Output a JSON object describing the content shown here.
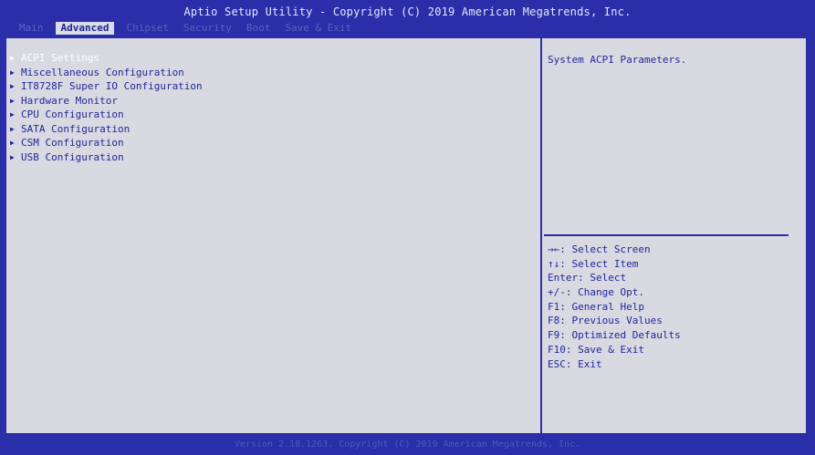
{
  "header": {
    "title": "Aptio Setup Utility - Copyright (C) 2019 American Megatrends, Inc.",
    "tabs": [
      {
        "label": "Main"
      },
      {
        "label": "Advanced"
      },
      {
        "label": "Chipset"
      },
      {
        "label": "Security"
      },
      {
        "label": "Boot"
      },
      {
        "label": "Save & Exit"
      }
    ],
    "active_tab": "Advanced"
  },
  "menu": {
    "items": [
      {
        "label": "ACPI Settings"
      },
      {
        "label": "Miscellaneous Configuration"
      },
      {
        "label": "IT8728F Super IO Configuration"
      },
      {
        "label": "Hardware Monitor"
      },
      {
        "label": "CPU Configuration"
      },
      {
        "label": "SATA Configuration"
      },
      {
        "label": "CSM Configuration"
      },
      {
        "label": "USB Configuration"
      }
    ],
    "selected": "ACPI Settings"
  },
  "help": {
    "description": "System ACPI Parameters."
  },
  "keys": [
    {
      "text": "→←: Select Screen"
    },
    {
      "text": "↑↓: Select Item"
    },
    {
      "text": "Enter: Select"
    },
    {
      "text": "+/-: Change Opt."
    },
    {
      "text": "F1: General Help"
    },
    {
      "text": "F8: Previous Values"
    },
    {
      "text": "F9: Optimized Defaults"
    },
    {
      "text": "F10: Save & Exit"
    },
    {
      "text": "ESC: Exit"
    }
  ],
  "footer": {
    "text": "Version 2.18.1263. Copyright (C) 2019 American Megatrends, Inc."
  }
}
